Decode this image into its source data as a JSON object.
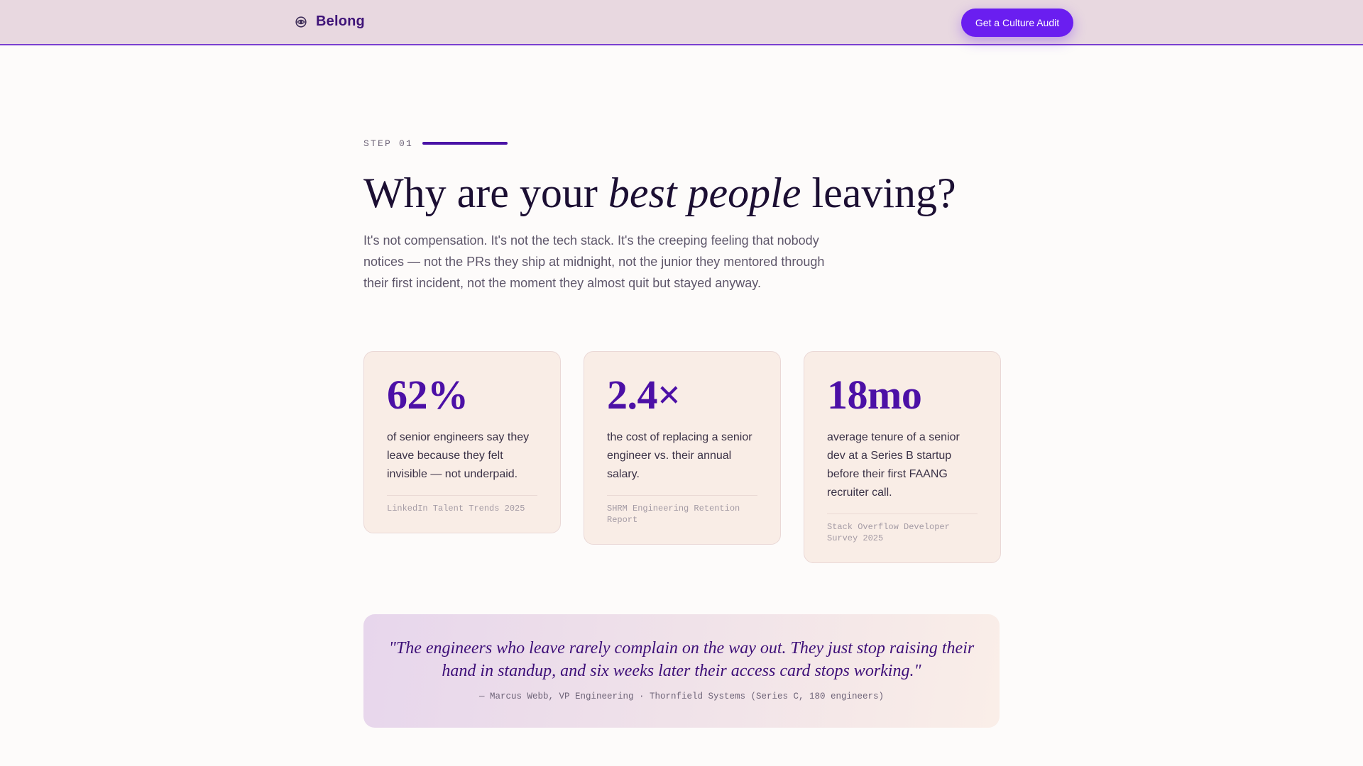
{
  "colors": {
    "header_bg": "#e8d8e0",
    "accent": "#6a1ef0",
    "brand_text": "#3f1478",
    "stat_value": "#4c10a6",
    "card_bg": "#f9ede6",
    "quote_text": "#3d0f78"
  },
  "header": {
    "brand_icon": "logo-mark-icon",
    "brand_name": "Belong",
    "cta_label": "Get a Culture Audit"
  },
  "section": {
    "eyebrow": "STEP 01",
    "headline_before": "Why are your ",
    "headline_emphasis": "best people",
    "headline_after": " leaving?",
    "lede": "It's not compensation. It's not the tech stack. It's the creeping feeling that nobody notices — not the PRs they ship at midnight, not the junior they mentored through their first incident, not the moment they almost quit but stayed anyway."
  },
  "stats": [
    {
      "value": "62%",
      "description": "of senior engineers say they leave because they felt invisible — not underpaid.",
      "source": "LinkedIn Talent Trends 2025"
    },
    {
      "value": "2.4×",
      "description": "the cost of replacing a senior engineer vs. their annual salary.",
      "source": "SHRM Engineering Retention Report"
    },
    {
      "value": "18mo",
      "description": "average tenure of a senior dev at a Series B startup before their first FAANG recruiter call.",
      "source": "Stack Overflow Developer Survey 2025"
    }
  ],
  "quote": {
    "text": "\"The engineers who leave rarely complain on the way out. They just stop raising their hand in standup, and six weeks later their access card stops working.\"",
    "attribution": "— Marcus Webb, VP Engineering · Thornfield Systems (Series C, 180 engineers)"
  }
}
